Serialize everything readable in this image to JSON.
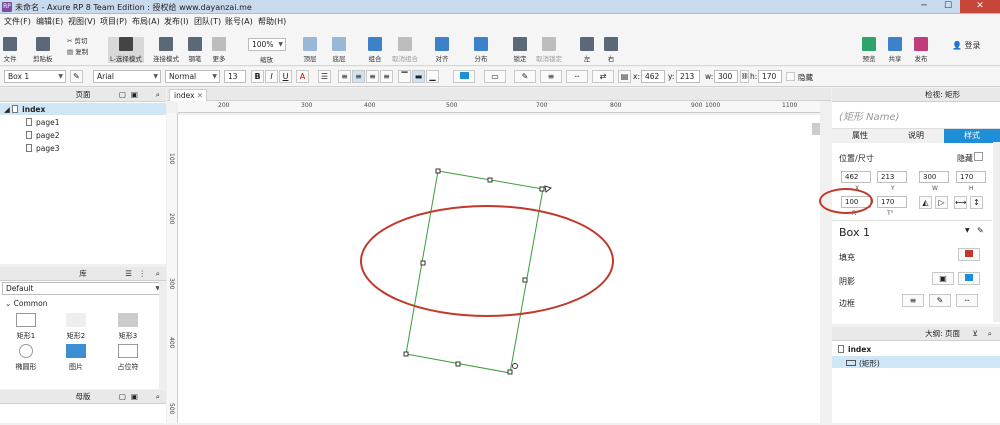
{
  "window": {
    "title": "未命名 - Axure RP 8 Team Edition : 授权给 www.dayanzai.me",
    "minimize": "─",
    "maximize": "☐",
    "close": "✕"
  },
  "menu": [
    "文件(F)",
    "编辑(E)",
    "视图(V)",
    "项目(P)",
    "布局(A)",
    "发布(I)",
    "团队(T)",
    "账号(A)",
    "帮助(H)"
  ],
  "toolbar": {
    "file": "文件",
    "clipboard": "剪贴板",
    "cut": "剪切",
    "copy": "复制",
    "select_mode": "L-选择模式",
    "connect_mode": "连接模式",
    "pen": "钢笔",
    "more": "更多",
    "zoom_value": "100%",
    "zoom": "缩放",
    "top": "顶层",
    "bottom": "底层",
    "group": "组合",
    "ungroup": "取消组合",
    "align": "对齐",
    "distribute": "分布",
    "lock": "锁定",
    "unlock": "取消锁定",
    "left": "左",
    "right": "右",
    "preview": "预览",
    "share": "共享",
    "publish": "发布",
    "login": "登录"
  },
  "format": {
    "widget_name": "Box 1",
    "font": "Arial",
    "style": "Normal",
    "size": "13",
    "bold": "B",
    "italic": "I",
    "underline": "U",
    "x_label": "x:",
    "x": "462",
    "y_label": "y:",
    "y": "213",
    "w_label": "w:",
    "w": "300",
    "h_label": "h:",
    "h": "170",
    "hidden": "隐藏"
  },
  "pages_panel": {
    "title": "页面",
    "root": "index",
    "pages": [
      "page1",
      "page2",
      "page3"
    ]
  },
  "library_panel": {
    "title": "库",
    "selected": "Default",
    "group": "Common",
    "items": [
      "矩形1",
      "矩形2",
      "矩形3",
      "椭圆形",
      "图片",
      "占位符"
    ]
  },
  "masters_panel": {
    "title": "母版"
  },
  "canvas": {
    "tab": "index",
    "ruler_h": [
      "200",
      "300",
      "400",
      "500",
      "600",
      "700",
      "800",
      "900",
      "1000",
      "1100"
    ],
    "ruler_v": [
      "100",
      "200",
      "300",
      "400",
      "500"
    ]
  },
  "inspector": {
    "title": "检视: 矩形",
    "name_placeholder": "(矩形 Name)",
    "tabs": [
      "属性",
      "说明",
      "样式"
    ],
    "section": "位置/尺寸",
    "hidden": "隐藏",
    "x": "462",
    "y": "213",
    "w": "300",
    "h": "170",
    "x_lbl": "X",
    "y_lbl": "Y",
    "w_lbl": "W",
    "h_lbl": "H",
    "rotation": "100",
    "text_rotation": "170",
    "r_lbl": "R°",
    "t_lbl": "T°",
    "style_name": "Box 1",
    "fill": "填充",
    "shadow": "阴影",
    "border": "边框"
  },
  "outline_panel": {
    "title": "大纲: 页面",
    "root": "index",
    "item": "(矩形)"
  },
  "colors": {
    "accent": "#1e8fd6",
    "fill": "#c0392b",
    "annotation": "#c0392b",
    "selection": "#3a9d3a"
  }
}
